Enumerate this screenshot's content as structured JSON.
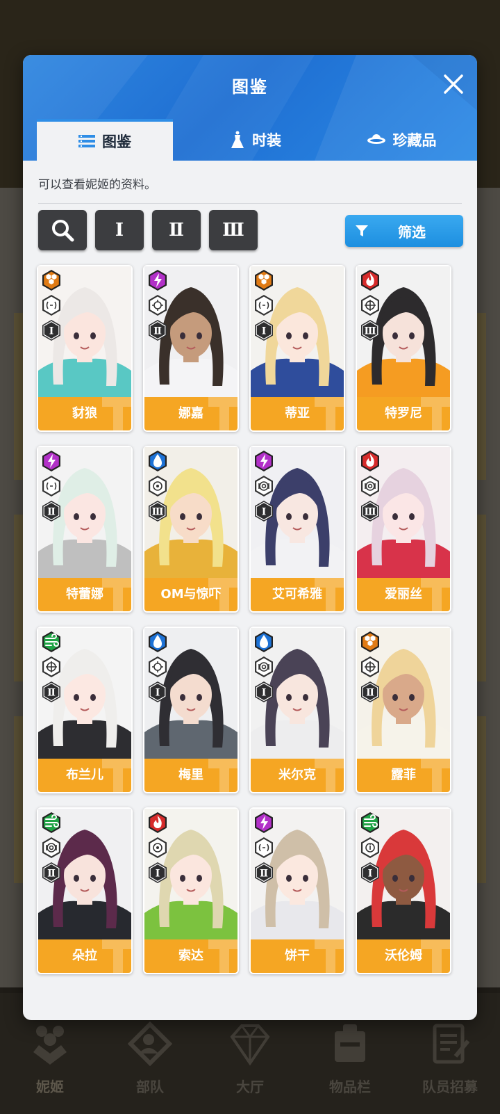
{
  "modal": {
    "title": "图鉴",
    "tabs": [
      {
        "label": "图鉴",
        "icon": "list-icon",
        "active": true
      },
      {
        "label": "时装",
        "icon": "dress-icon",
        "active": false
      },
      {
        "label": "珍藏品",
        "icon": "planet-icon",
        "active": false
      }
    ],
    "subtitle": "可以查看妮姬的资料。",
    "filters": {
      "search_icon": "magnifier-icon",
      "tiers": [
        "Ⅰ",
        "Ⅱ",
        "Ⅲ"
      ],
      "screen_label": "筛选"
    }
  },
  "colors": {
    "header_blue": "#2379d9",
    "card_bar": "#f5a623",
    "elements": {
      "iron": "#e07b15",
      "electric": "#b230c8",
      "fire": "#d62b2b",
      "water": "#1d72d6",
      "wind": "#1fa345"
    }
  },
  "characters": [
    {
      "name": "豺狼",
      "element": "iron",
      "weapon": "rl",
      "burst": "Ⅰ",
      "portrait": {
        "hair": "#ece8e6",
        "skin": "#fbe5de",
        "outfit": "#59c8c4",
        "bg": "#f6f3f1"
      }
    },
    {
      "name": "娜嘉",
      "element": "electric",
      "weapon": "smg",
      "burst": "Ⅱ",
      "portrait": {
        "hair": "#3a302a",
        "skin": "#c59b7c",
        "outfit": "#f4f4f6",
        "bg": "#f0f0f2"
      }
    },
    {
      "name": "蒂亚",
      "element": "iron",
      "weapon": "rl",
      "burst": "Ⅰ",
      "portrait": {
        "hair": "#f0d79a",
        "skin": "#fbe7dc",
        "outfit": "#2f4d9c",
        "bg": "#f3f2ef"
      }
    },
    {
      "name": "特罗尼",
      "element": "fire",
      "weapon": "sr",
      "burst": "Ⅲ",
      "portrait": {
        "hair": "#2d2b2d",
        "skin": "#f6e2da",
        "outfit": "#f59c22",
        "bg": "#f2f2f2"
      }
    },
    {
      "name": "特蕾娜",
      "element": "electric",
      "weapon": "rl",
      "burst": "Ⅱ",
      "portrait": {
        "hair": "#dfeee6",
        "skin": "#fbe6e2",
        "outfit": "#bfbfbf",
        "bg": "#f3f3f3"
      }
    },
    {
      "name": "OM与惊吓",
      "element": "water",
      "weapon": "sg",
      "burst": "Ⅲ",
      "portrait": {
        "hair": "#f2e18c",
        "skin": "#f7dcc8",
        "outfit": "#e8b23a",
        "bg": "#f2efe8"
      }
    },
    {
      "name": "艾可希雅",
      "element": "electric",
      "weapon": "ar",
      "burst": "Ⅰ",
      "portrait": {
        "hair": "#3c3f6a",
        "skin": "#f8e7e1",
        "outfit": "#f2f2f4",
        "bg": "#f0f0f3"
      }
    },
    {
      "name": "爱丽丝",
      "element": "fire",
      "weapon": "ar",
      "burst": "Ⅲ",
      "portrait": {
        "hair": "#e6d2df",
        "skin": "#fbe6e6",
        "outfit": "#d8334a",
        "bg": "#f4eef0"
      }
    },
    {
      "name": "布兰儿",
      "element": "wind",
      "weapon": "sr",
      "burst": "Ⅱ",
      "portrait": {
        "hair": "#efeeec",
        "skin": "#fce8e2",
        "outfit": "#2d2d31",
        "bg": "#f4f4f4"
      }
    },
    {
      "name": "梅里",
      "element": "water",
      "weapon": "smg",
      "burst": "Ⅰ",
      "portrait": {
        "hair": "#2f2e33",
        "skin": "#f4dccf",
        "outfit": "#5f6770",
        "bg": "#eeeff1"
      }
    },
    {
      "name": "米尔克",
      "element": "water",
      "weapon": "ar",
      "burst": "Ⅰ",
      "portrait": {
        "hair": "#4a4356",
        "skin": "#f8e6de",
        "outfit": "#ededee",
        "bg": "#f1f1f1"
      }
    },
    {
      "name": "露菲",
      "element": "iron",
      "weapon": "sr",
      "burst": "Ⅱ",
      "portrait": {
        "hair": "#efd49a",
        "skin": "#d9a98a",
        "outfit": "#f6f3ea",
        "bg": "#f5f2ea"
      }
    },
    {
      "name": "朵拉",
      "element": "wind",
      "weapon": "ar",
      "burst": "Ⅱ",
      "portrait": {
        "hair": "#5c2a4b",
        "skin": "#f8e3dc",
        "outfit": "#27292f",
        "bg": "#f0f0f2"
      }
    },
    {
      "name": "索达",
      "element": "fire",
      "weapon": "sg",
      "burst": "Ⅰ",
      "portrait": {
        "hair": "#dfd7b0",
        "skin": "#fbe6de",
        "outfit": "#7cc23f",
        "bg": "#f4f3ee"
      }
    },
    {
      "name": "饼干",
      "element": "electric",
      "weapon": "rl",
      "burst": "Ⅱ",
      "portrait": {
        "hair": "#cfbfa8",
        "skin": "#fbe8df",
        "outfit": "#e8e8ec",
        "bg": "#f3f2f1"
      }
    },
    {
      "name": "沃伦姆",
      "element": "wind",
      "weapon": "mg",
      "burst": "Ⅰ",
      "portrait": {
        "hair": "#d9393a",
        "skin": "#8e5a41",
        "outfit": "#2b2b2b",
        "bg": "#f3f0ef"
      }
    }
  ],
  "bottom_nav": [
    {
      "label": "妮姬",
      "icon": "nikke-icon",
      "active": true
    },
    {
      "label": "部队",
      "icon": "squad-icon",
      "active": false
    },
    {
      "label": "大厅",
      "icon": "lobby-icon",
      "active": false
    },
    {
      "label": "物品栏",
      "icon": "inventory-icon",
      "active": false
    },
    {
      "label": "队员招募",
      "icon": "recruit-icon",
      "active": false
    }
  ]
}
